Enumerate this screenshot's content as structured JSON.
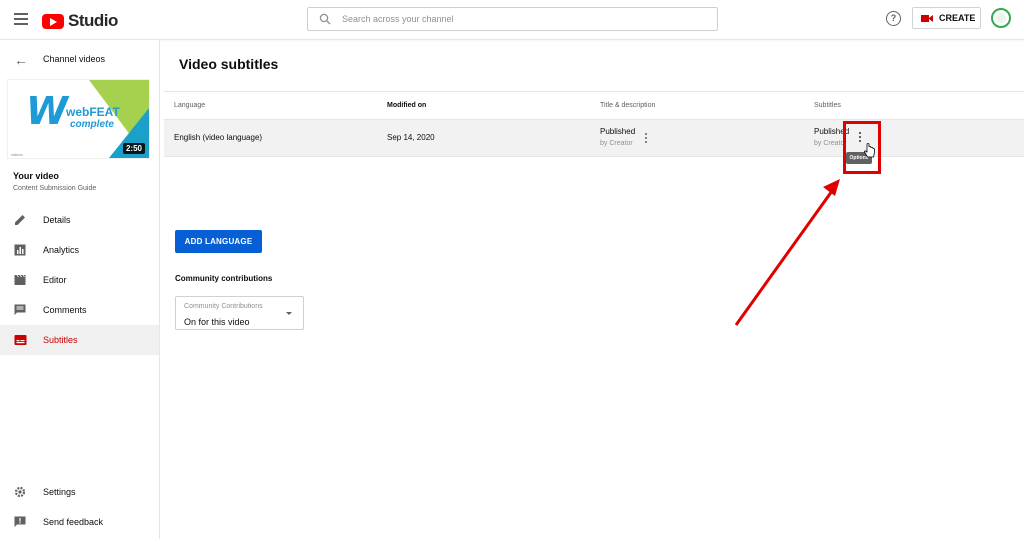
{
  "app": {
    "logo_text": "Studio"
  },
  "search": {
    "placeholder": "Search across your channel"
  },
  "header": {
    "create_label": "CREATE",
    "help_glyph": "?"
  },
  "sidebar": {
    "back_label": "Channel videos",
    "thumbnail": {
      "brand_letter": "W",
      "brand_line1": "webFEAT",
      "brand_line2": "complete",
      "small_text": "videos",
      "duration": "2:50"
    },
    "your_video_title": "Your video",
    "your_video_subtitle": "Content Submission Guide",
    "items": [
      {
        "label": "Details",
        "icon": "pencil-icon"
      },
      {
        "label": "Analytics",
        "icon": "analytics-icon"
      },
      {
        "label": "Editor",
        "icon": "clapperboard-icon"
      },
      {
        "label": "Comments",
        "icon": "comments-icon"
      },
      {
        "label": "Subtitles",
        "icon": "subtitles-icon",
        "active": true
      }
    ],
    "bottom_items": [
      {
        "label": "Settings",
        "icon": "gear-icon"
      },
      {
        "label": "Send feedback",
        "icon": "feedback-icon"
      }
    ]
  },
  "main": {
    "title": "Video subtitles",
    "table": {
      "headers": [
        "Language",
        "Modified on",
        "Title & description",
        "Subtitles"
      ],
      "rows": [
        {
          "language": "English (video language)",
          "modified": "Sep 14, 2020",
          "title_status": "Published",
          "title_by": "by Creator",
          "subtitles_status": "Published",
          "subtitles_by": "by Creator"
        }
      ]
    },
    "tooltip": "Options",
    "add_language_label": "ADD LANGUAGE",
    "community": {
      "title": "Community contributions",
      "select_label": "Community Contributions",
      "select_value": "On for this video"
    }
  },
  "colors": {
    "accent_blue": "#065fd4",
    "active_red": "#cc0000",
    "annotation_red": "#e00000"
  }
}
